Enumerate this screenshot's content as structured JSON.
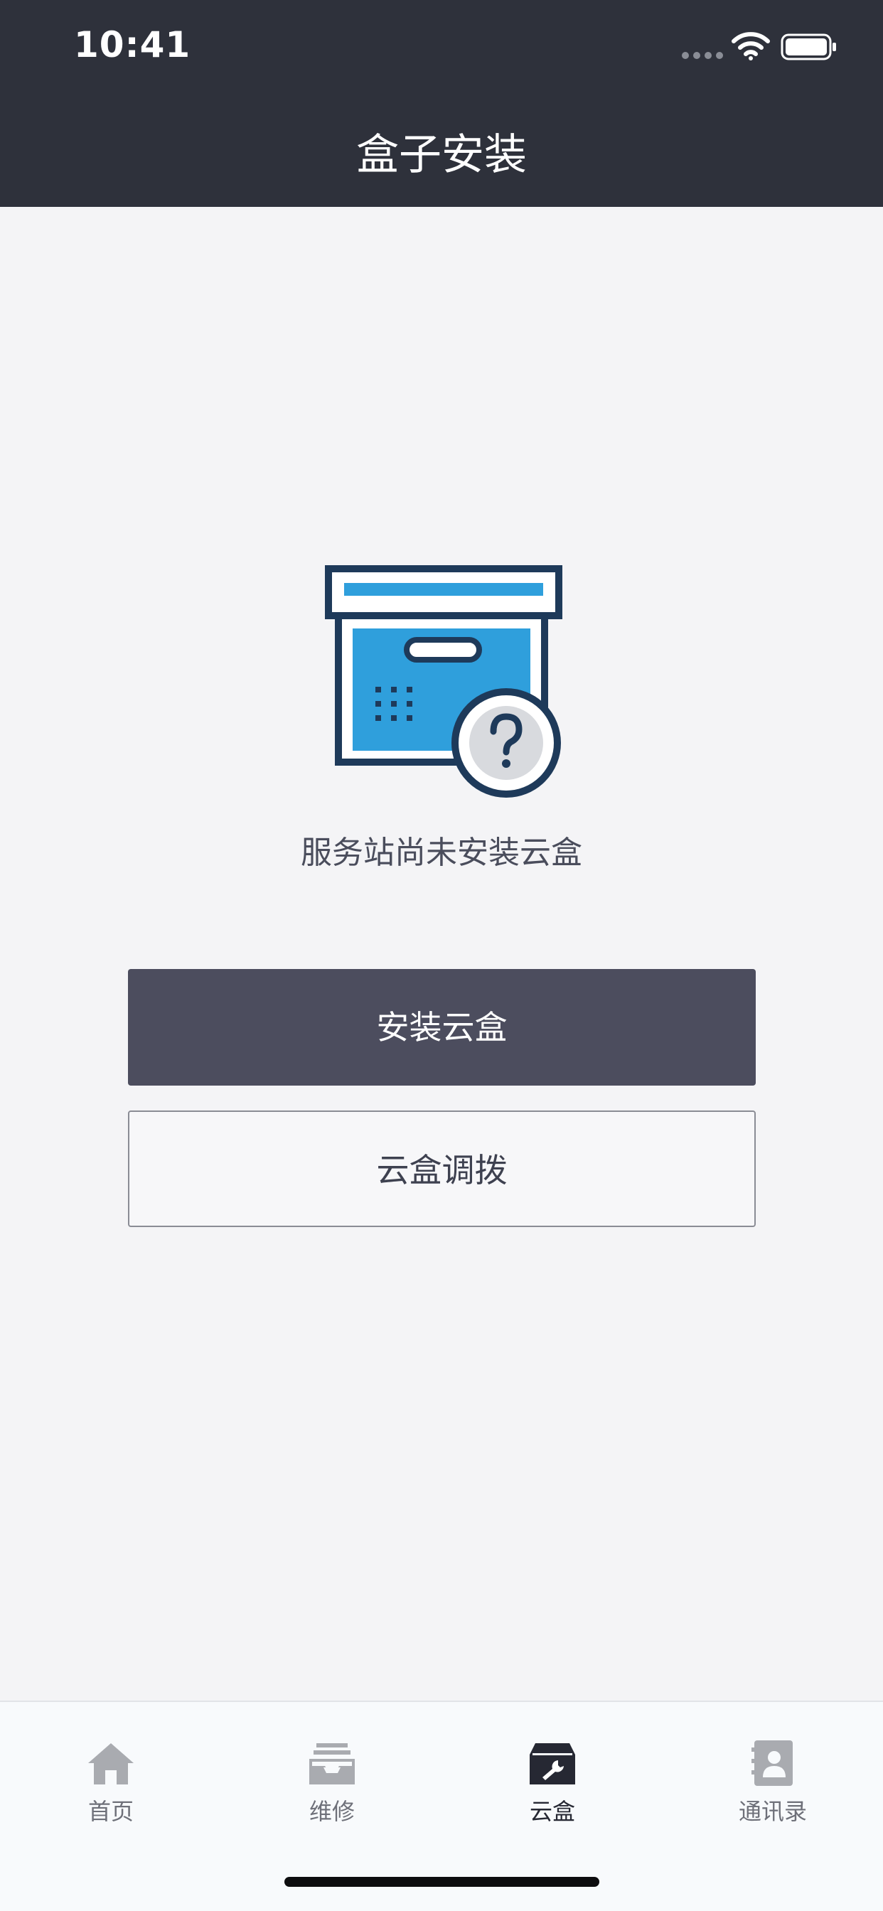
{
  "status_bar": {
    "time": "10:41"
  },
  "header": {
    "title": "盒子安装"
  },
  "empty_state": {
    "illustration": "box-question-icon",
    "message": "服务站尚未安装云盒"
  },
  "actions": {
    "install_label": "安装云盒",
    "transfer_label": "云盒调拨"
  },
  "tabbar": {
    "tabs": [
      {
        "label": "首页",
        "icon": "home-icon",
        "active": false
      },
      {
        "label": "维修",
        "icon": "inbox-icon",
        "active": false
      },
      {
        "label": "云盒",
        "icon": "box-wrench-icon",
        "active": true
      },
      {
        "label": "通讯录",
        "icon": "contact-book-icon",
        "active": false
      }
    ]
  },
  "colors": {
    "header_bg": "#2e313b",
    "page_bg": "#f4f4f6",
    "primary_button": "#4c4d5e",
    "illustration_blue": "#2f9fdc",
    "illustration_outline": "#1e3a5a"
  }
}
